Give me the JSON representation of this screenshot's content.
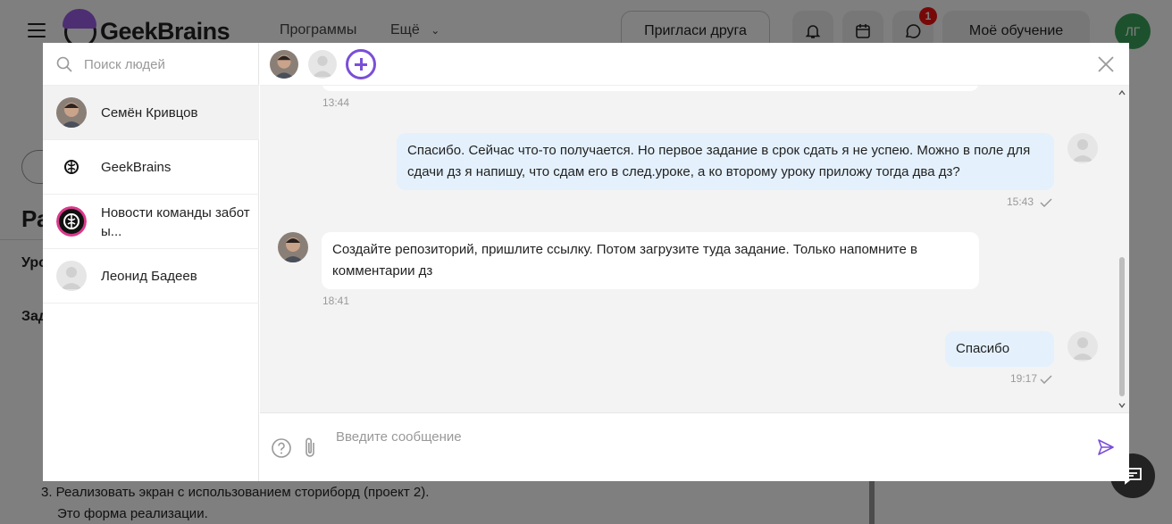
{
  "page": {
    "logo_text": "GeekBrains",
    "nav": {
      "programs": "Программы",
      "more": "Ещё"
    },
    "invite_label": "Пригласи друга",
    "notifications_badge": "1",
    "my_learning_label": "Моё обучение",
    "user_initials": "ЛГ",
    "heading_fragment": "Ра",
    "sub1_fragment": "Уро",
    "sub2_fragment": "Зад",
    "task_list": [
      "3. Реализовать экран с использованием сториборд (проект 2).",
      "Это форма реализации."
    ]
  },
  "chat": {
    "search_placeholder": "Поиск людей",
    "contacts": [
      {
        "name": "Семён Кривцов",
        "active": true,
        "avatar": "photo"
      },
      {
        "name": "GeekBrains",
        "active": false,
        "avatar": "geekbrains-logo"
      },
      {
        "name": "Новости команды забот ы...",
        "active": false,
        "avatar": "geekbrains-logo-pink"
      },
      {
        "name": "Леонид Бадеев",
        "active": false,
        "avatar": "placeholder"
      }
    ],
    "messages": [
      {
        "direction": "in",
        "text": "",
        "time": "13:44"
      },
      {
        "direction": "out",
        "text": "Спасибо. Сейчас что-то получается. Но первое задание в срок сдать я не успею. Можно в поле для сдачи дз я напишу, что сдам его в след.уроке, а ко второму уроку приложу тогда два дз?",
        "time": "15:43"
      },
      {
        "direction": "in",
        "text": "Создайте репозиторий, пришлите ссылку. Потом загрузите туда задание. Только напомните в комментарии дз",
        "time": "18:41"
      },
      {
        "direction": "out",
        "text": "Спасибо",
        "time": "19:17"
      }
    ],
    "composer_placeholder": "Введите сообщение"
  },
  "colors": {
    "accent": "#7a4fd8",
    "outgoing_bubble": "#e4f1fd",
    "badge": "#e11111",
    "user_avatar": "#3aa35a"
  }
}
